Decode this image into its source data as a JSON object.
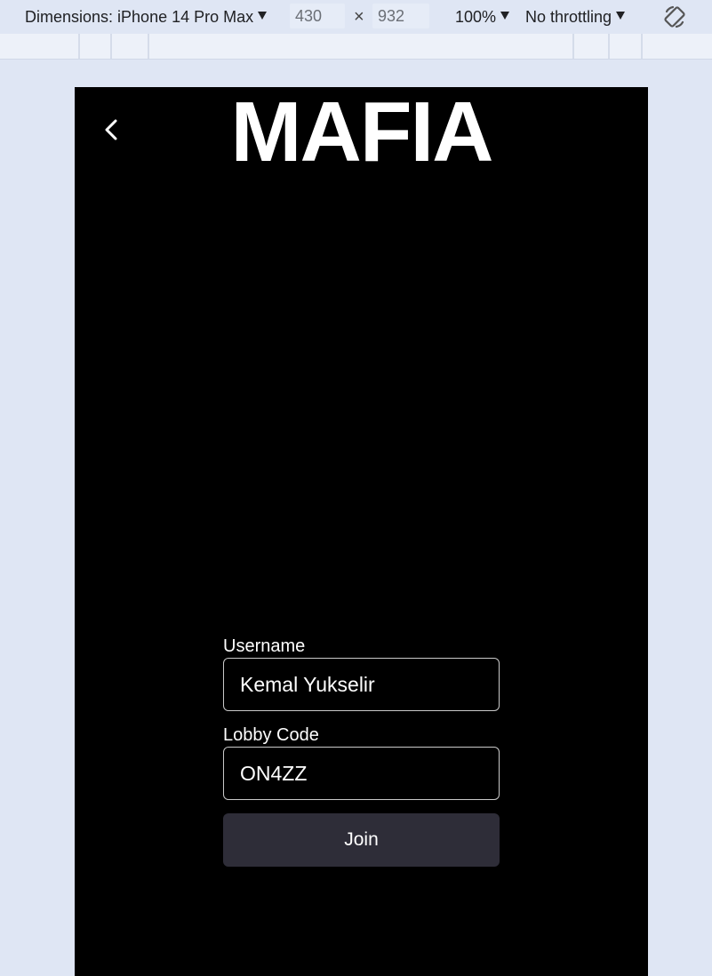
{
  "devtools": {
    "dimensions_label": "Dimensions: iPhone 14 Pro Max",
    "width_value": "430",
    "height_value": "932",
    "times_symbol": "×",
    "zoom_label": "100%",
    "throttling_label": "No throttling",
    "rotate_icon": "rotate-icon"
  },
  "app": {
    "title": "MAFIA",
    "back_icon": "chevron-left-icon",
    "background_color": "#000000",
    "form": {
      "username_label": "Username",
      "username_value": "Kemal Yukselir",
      "lobby_code_label": "Lobby Code",
      "lobby_code_value": "ON4ZZ",
      "join_label": "Join",
      "join_color": "#2e2d38"
    }
  }
}
